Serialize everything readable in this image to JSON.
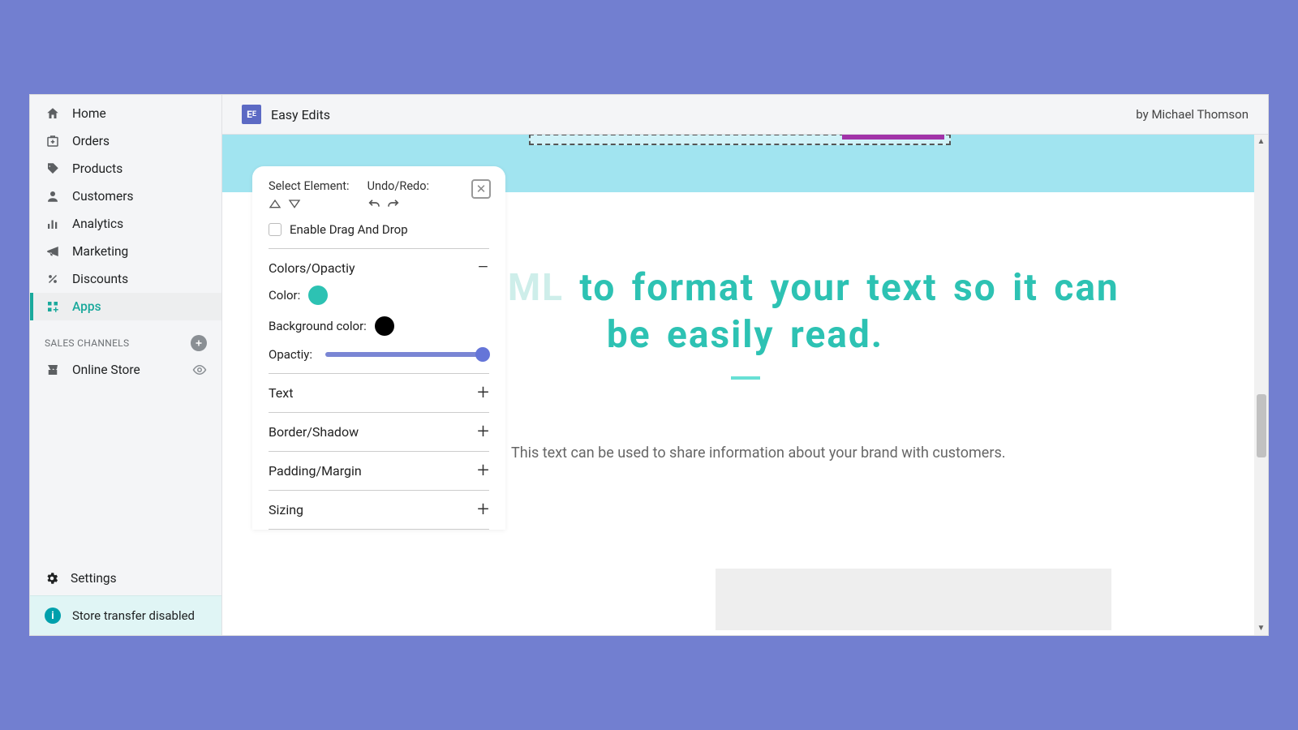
{
  "topbar": {
    "app_name": "Easy Edits",
    "author": "by Michael Thomson"
  },
  "sidebar": {
    "items": [
      {
        "label": "Home"
      },
      {
        "label": "Orders"
      },
      {
        "label": "Products"
      },
      {
        "label": "Customers"
      },
      {
        "label": "Analytics"
      },
      {
        "label": "Marketing"
      },
      {
        "label": "Discounts"
      },
      {
        "label": "Apps"
      }
    ],
    "section_header": "SALES CHANNELS",
    "channels": [
      {
        "label": "Online Store"
      }
    ],
    "settings_label": "Settings",
    "transfer_label": "Store transfer disabled"
  },
  "inspector": {
    "select_label": "Select Element:",
    "undo_label": "Undo/Redo:",
    "drag_label": "Enable Drag And Drop",
    "sections": {
      "colors": {
        "title": "Colors/Opactiy",
        "color_label": "Color:",
        "bg_label": "Background color:",
        "opacity_label": "Opactiy:",
        "color_value": "#2dc2b3",
        "bg_value": "#000000",
        "opacity_value": 100
      },
      "text": {
        "title": "Text"
      },
      "border": {
        "title": "Border/Shadow"
      },
      "padding": {
        "title": "Padding/Margin"
      },
      "sizing": {
        "title": "Sizing"
      }
    }
  },
  "canvas": {
    "headline_faded": "Use HTML",
    "headline_rest": " to format your text so it can be easily read.",
    "bodytext": "This text can be used to share information about your brand with customers."
  }
}
